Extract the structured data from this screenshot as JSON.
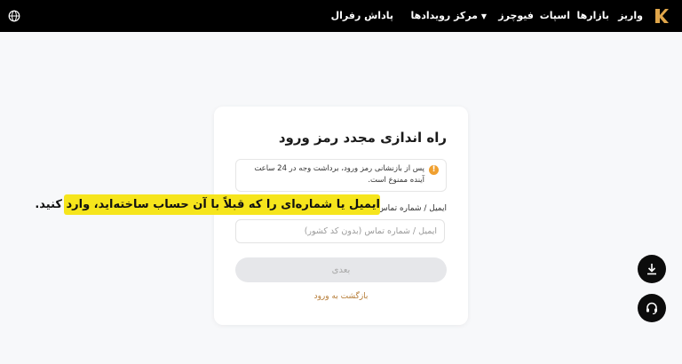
{
  "header": {
    "nav": {
      "deposit": "واریز",
      "markets": "بازارها",
      "spot": "اسپات",
      "futures": "فیوچرز",
      "events": "مرکز رویدادها",
      "referral": "پاداش رفرال"
    }
  },
  "card": {
    "title": "راه اندازی مجدد رمز ورود",
    "notice": "پس از بازنشانی رمز ورود، برداشت وجه در 24 ساعت آینده ممنوع است.",
    "field_label": "ایمیل / شماره تماس",
    "input_placeholder": "ایمیل / شماره تماس (بدون کد کشور)",
    "input_value": "",
    "next_label": "بعدی",
    "back_label": "بازگشت به ورود"
  },
  "tooltip": "ایمیل یا شماره‌ای را که قبلاً با آن حساب ساخته‌اید، وارد کنید.",
  "icons": {
    "logo": "logo-icon",
    "globe": "globe-icon",
    "warning": "warning-icon",
    "download": "download-icon",
    "support": "headset-icon"
  },
  "colors": {
    "accent": "#b57b35",
    "warning": "#f0a030",
    "tooltip": "#f6e51c"
  }
}
